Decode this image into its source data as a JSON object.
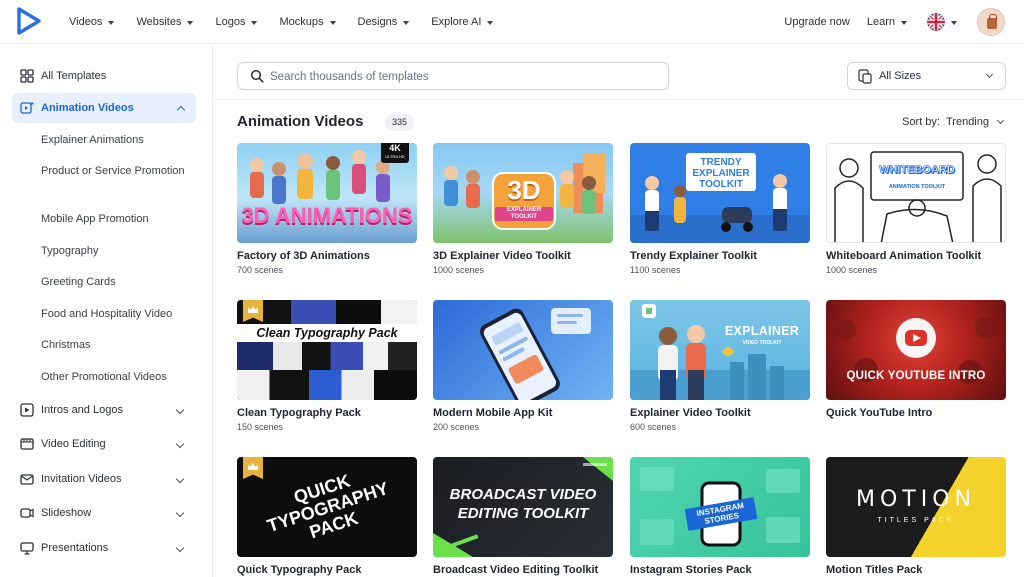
{
  "nav": {
    "items": [
      {
        "label": "Videos"
      },
      {
        "label": "Websites"
      },
      {
        "label": "Logos"
      },
      {
        "label": "Mockups"
      },
      {
        "label": "Designs"
      },
      {
        "label": "Explore AI"
      }
    ],
    "upgrade": "Upgrade now",
    "learn": "Learn"
  },
  "sidebar": {
    "all_templates": "All Templates",
    "active": "Animation Videos",
    "sub_items": [
      "Explainer Animations",
      "Product or Service Promotion",
      "Mobile App Promotion",
      "Typography",
      "Greeting Cards",
      "Food and Hospitality Video",
      "Christmas",
      "Other Promotional Videos"
    ],
    "sections": [
      {
        "label": "Intros and Logos",
        "icon": "intro-icon"
      },
      {
        "label": "Video Editing",
        "icon": "video-edit-icon"
      },
      {
        "label": "Invitation Videos",
        "icon": "invitation-icon"
      },
      {
        "label": "Slideshow",
        "icon": "slideshow-icon"
      },
      {
        "label": "Presentations",
        "icon": "presentation-icon"
      }
    ]
  },
  "search": {
    "placeholder": "Search thousands of templates"
  },
  "sizes": {
    "label": "All Sizes"
  },
  "header": {
    "title": "Animation Videos",
    "count": "335",
    "sort_label": "Sort by:",
    "sort_value": "Trending"
  },
  "cards": [
    {
      "title": "Factory of 3D Animations",
      "scenes": "700 scenes",
      "thumb_text": "3D ANIMATIONS",
      "badge": "4K",
      "badge_sub": "ULTRA HD"
    },
    {
      "title": "3D Explainer Video Toolkit",
      "scenes": "1000 scenes",
      "thumb_text": "3D",
      "thumb_sub": "EXPLAINER TOOLKIT"
    },
    {
      "title": "Trendy Explainer Toolkit",
      "scenes": "1100 scenes",
      "thumb_text": "TRENDY EXPLAINER TOOLKIT"
    },
    {
      "title": "Whiteboard Animation Toolkit",
      "scenes": "1000 scenes",
      "thumb_text": "WHITEBOARD",
      "thumb_sub": "ANIMATION TOOLKIT"
    },
    {
      "title": "Clean Typography Pack",
      "scenes": "150 scenes",
      "thumb_text": "Clean Typography Pack"
    },
    {
      "title": "Modern Mobile App Kit",
      "scenes": "200 scenes"
    },
    {
      "title": "Explainer Video Toolkit",
      "scenes": "600 scenes",
      "thumb_text": "EXPLAINER",
      "thumb_sub": "VIDEO TOOLKIT"
    },
    {
      "title": "Quick YouTube Intro",
      "scenes": "",
      "thumb_text": "QUICK YOUTUBE INTRO"
    },
    {
      "title": "Quick Typography Pack",
      "scenes": "",
      "thumb_text": "QUICK TYPOGRAPHY PACK"
    },
    {
      "title": "Broadcast Video Editing Toolkit",
      "scenes": "",
      "thumb_text": "BROADCAST VIDEO EDITING TOOLKIT"
    },
    {
      "title": "Instagram Stories Pack",
      "scenes": "",
      "thumb_text": "INSTAGRAM STORIES"
    },
    {
      "title": "Motion Titles Pack",
      "scenes": "",
      "thumb_text": "MOTION",
      "thumb_sub": "TITLES PACK"
    }
  ],
  "colors": {
    "accent": "#1a66d6",
    "active_bg": "#e8f0fd",
    "premium": "#e8b33c"
  }
}
